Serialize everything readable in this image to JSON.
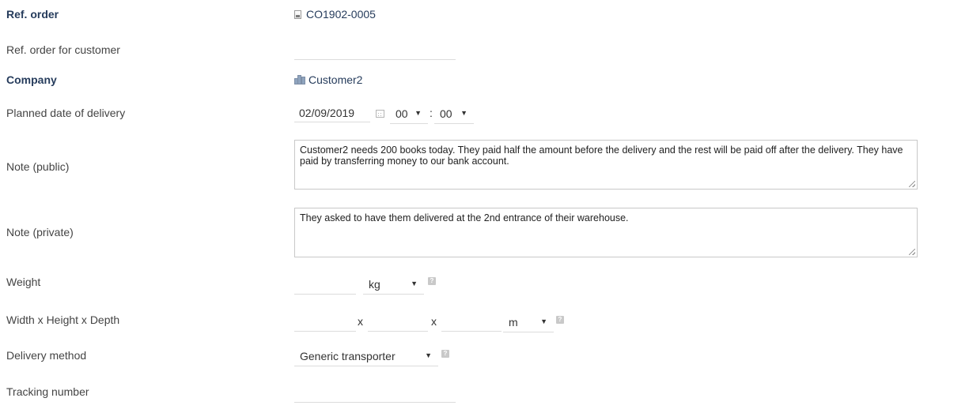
{
  "fields": {
    "ref_order": {
      "label": "Ref. order",
      "value": "CO1902-0005",
      "icon": "document-icon"
    },
    "ref_order_customer": {
      "label": "Ref. order for customer",
      "value": ""
    },
    "company": {
      "label": "Company",
      "value": "Customer2",
      "icon": "company-icon"
    },
    "planned_delivery": {
      "label": "Planned date of delivery",
      "date": "02/09/2019",
      "hour": "00",
      "minute": "00",
      "time_separator": ":"
    },
    "note_public": {
      "label": "Note (public)",
      "value": "Customer2 needs 200 books today. They paid half the amount before the delivery and the rest will be paid off after the delivery. They have paid by transferring money to our bank account."
    },
    "note_private": {
      "label": "Note (private)",
      "value": "They asked to have them delivered at the 2nd entrance of their warehouse."
    },
    "weight": {
      "label": "Weight",
      "value": "",
      "unit": "kg"
    },
    "dimensions": {
      "label": "Width x Height x Depth",
      "width": "",
      "height": "",
      "depth": "",
      "separator": "x",
      "unit": "m"
    },
    "delivery_method": {
      "label": "Delivery method",
      "value": "Generic transporter"
    },
    "tracking_number": {
      "label": "Tracking number",
      "value": ""
    }
  },
  "icons": {
    "help": "?",
    "dropdown_arrow": "▼"
  },
  "colors": {
    "bold_label": "#263c5c",
    "link": "#263c5c",
    "label": "#444444",
    "border": "#dcdcdc"
  }
}
